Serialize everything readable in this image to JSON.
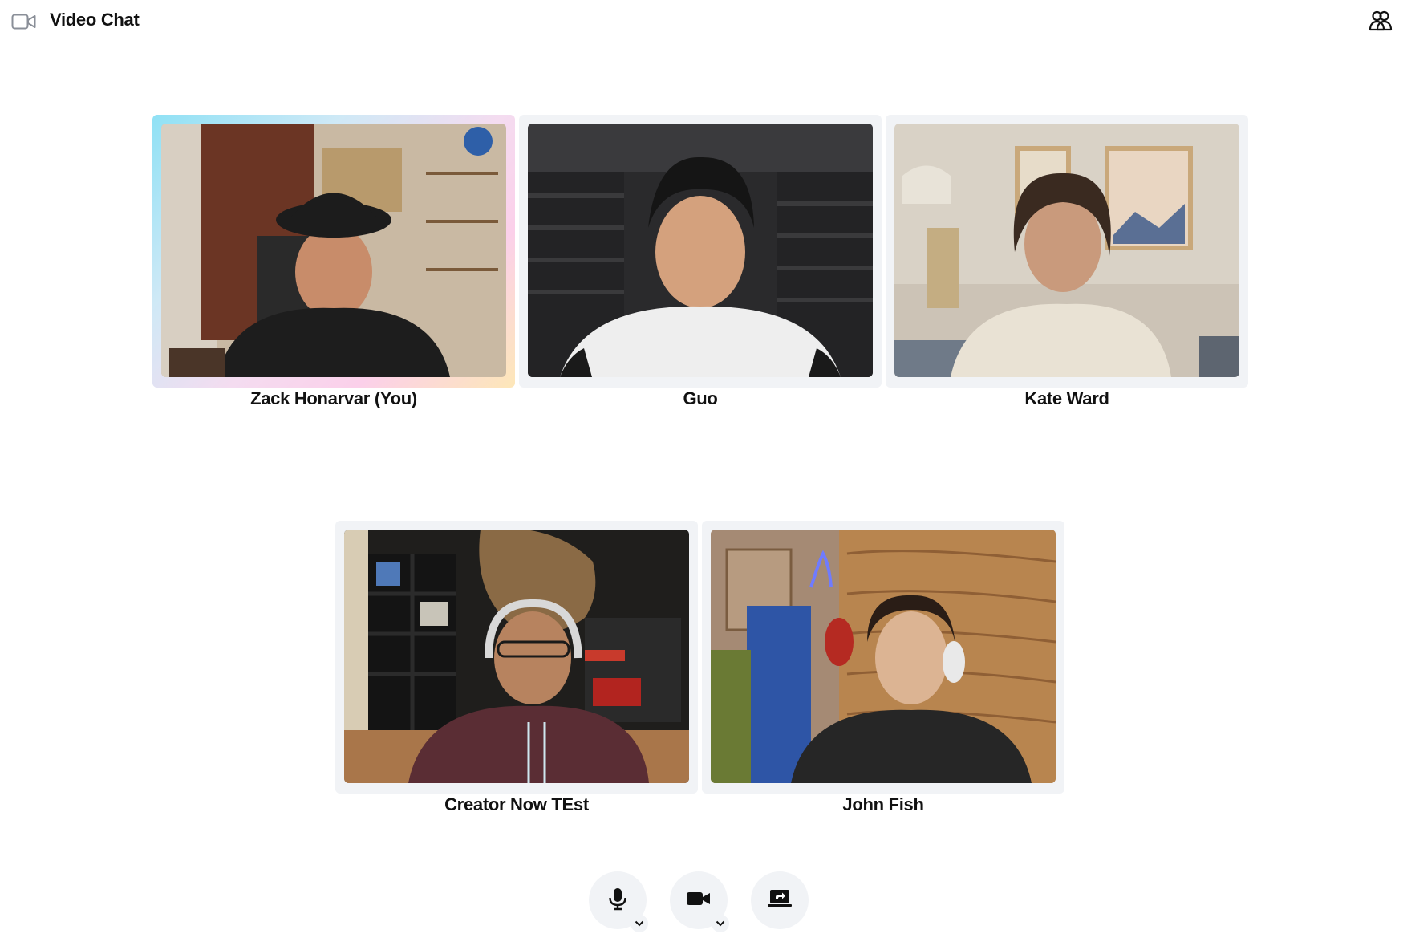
{
  "header": {
    "title": "Video Chat",
    "icon": "video-camera-icon",
    "participants_icon": "participants-icon"
  },
  "participants": [
    {
      "name": "Zack Honarvar (You)",
      "is_self": true
    },
    {
      "name": "Guo",
      "is_self": false
    },
    {
      "name": "Kate Ward",
      "is_self": false
    },
    {
      "name": "Creator Now TEst",
      "is_self": false
    },
    {
      "name": "John Fish",
      "is_self": false
    }
  ],
  "controls": {
    "mic_icon": "microphone-icon",
    "camera_icon": "video-camera-icon",
    "share_icon": "screen-share-icon",
    "menu_icon": "chevron-down-icon"
  },
  "colors": {
    "tile_background": "#f1f3f6",
    "control_background": "#f1f3f6",
    "self_border_gradient": [
      "#8fe1f5",
      "#f4dcf0",
      "#fde7b8"
    ]
  }
}
